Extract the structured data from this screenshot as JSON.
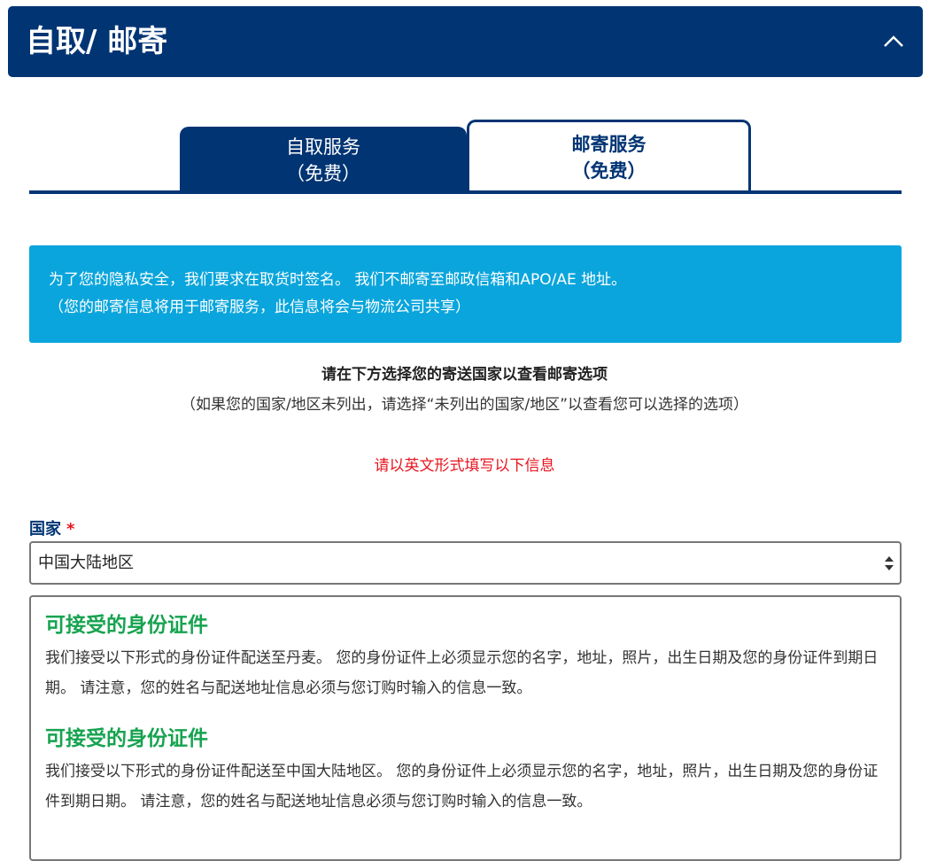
{
  "header": {
    "title": "自取/ 邮寄"
  },
  "tabs": [
    {
      "line1": "自取服务",
      "line2": "（免费）"
    },
    {
      "line1": "邮寄服务",
      "line2": "（免费）"
    }
  ],
  "notice": {
    "line1": "为了您的隐私安全，我们要求在取货时签名。 我们不邮寄至邮政信箱和APO/AE 地址。",
    "line2": "（您的邮寄信息将用于邮寄服务，此信息将会与物流公司共享）"
  },
  "instructions": {
    "title": "请在下方选择您的寄送国家以查看邮寄选项",
    "subtitle": "（如果您的国家/地区未列出，请选择“未列出的国家/地区”以查看您可以选择的选项）"
  },
  "english_note": "请以英文形式填写以下信息",
  "country": {
    "label": "国家",
    "required_mark": "*",
    "selected": "中国大陆地区"
  },
  "id_sections": [
    {
      "title": "可接受的身份证件",
      "text": "我们接受以下形式的身份证件配送至丹麦。 您的身份证件上必须显示您的名字，地址，照片，出生日期及您的身份证件到期日期。 请注意，您的姓名与配送地址信息必须与您订购时输入的信息一致。"
    },
    {
      "title": "可接受的身份证件",
      "text": "我们接受以下形式的身份证件配送至中国大陆地区。 您的身份证件上必须显示您的名字，地址，照片，出生日期及您的身份证件到期日期。 请注意，您的姓名与配送地址信息必须与您订购时输入的信息一致。"
    }
  ],
  "colors": {
    "navy": "#003473",
    "notice_blue": "#0aa5dc",
    "required_red": "#e8141e",
    "id_green": "#17a350"
  }
}
